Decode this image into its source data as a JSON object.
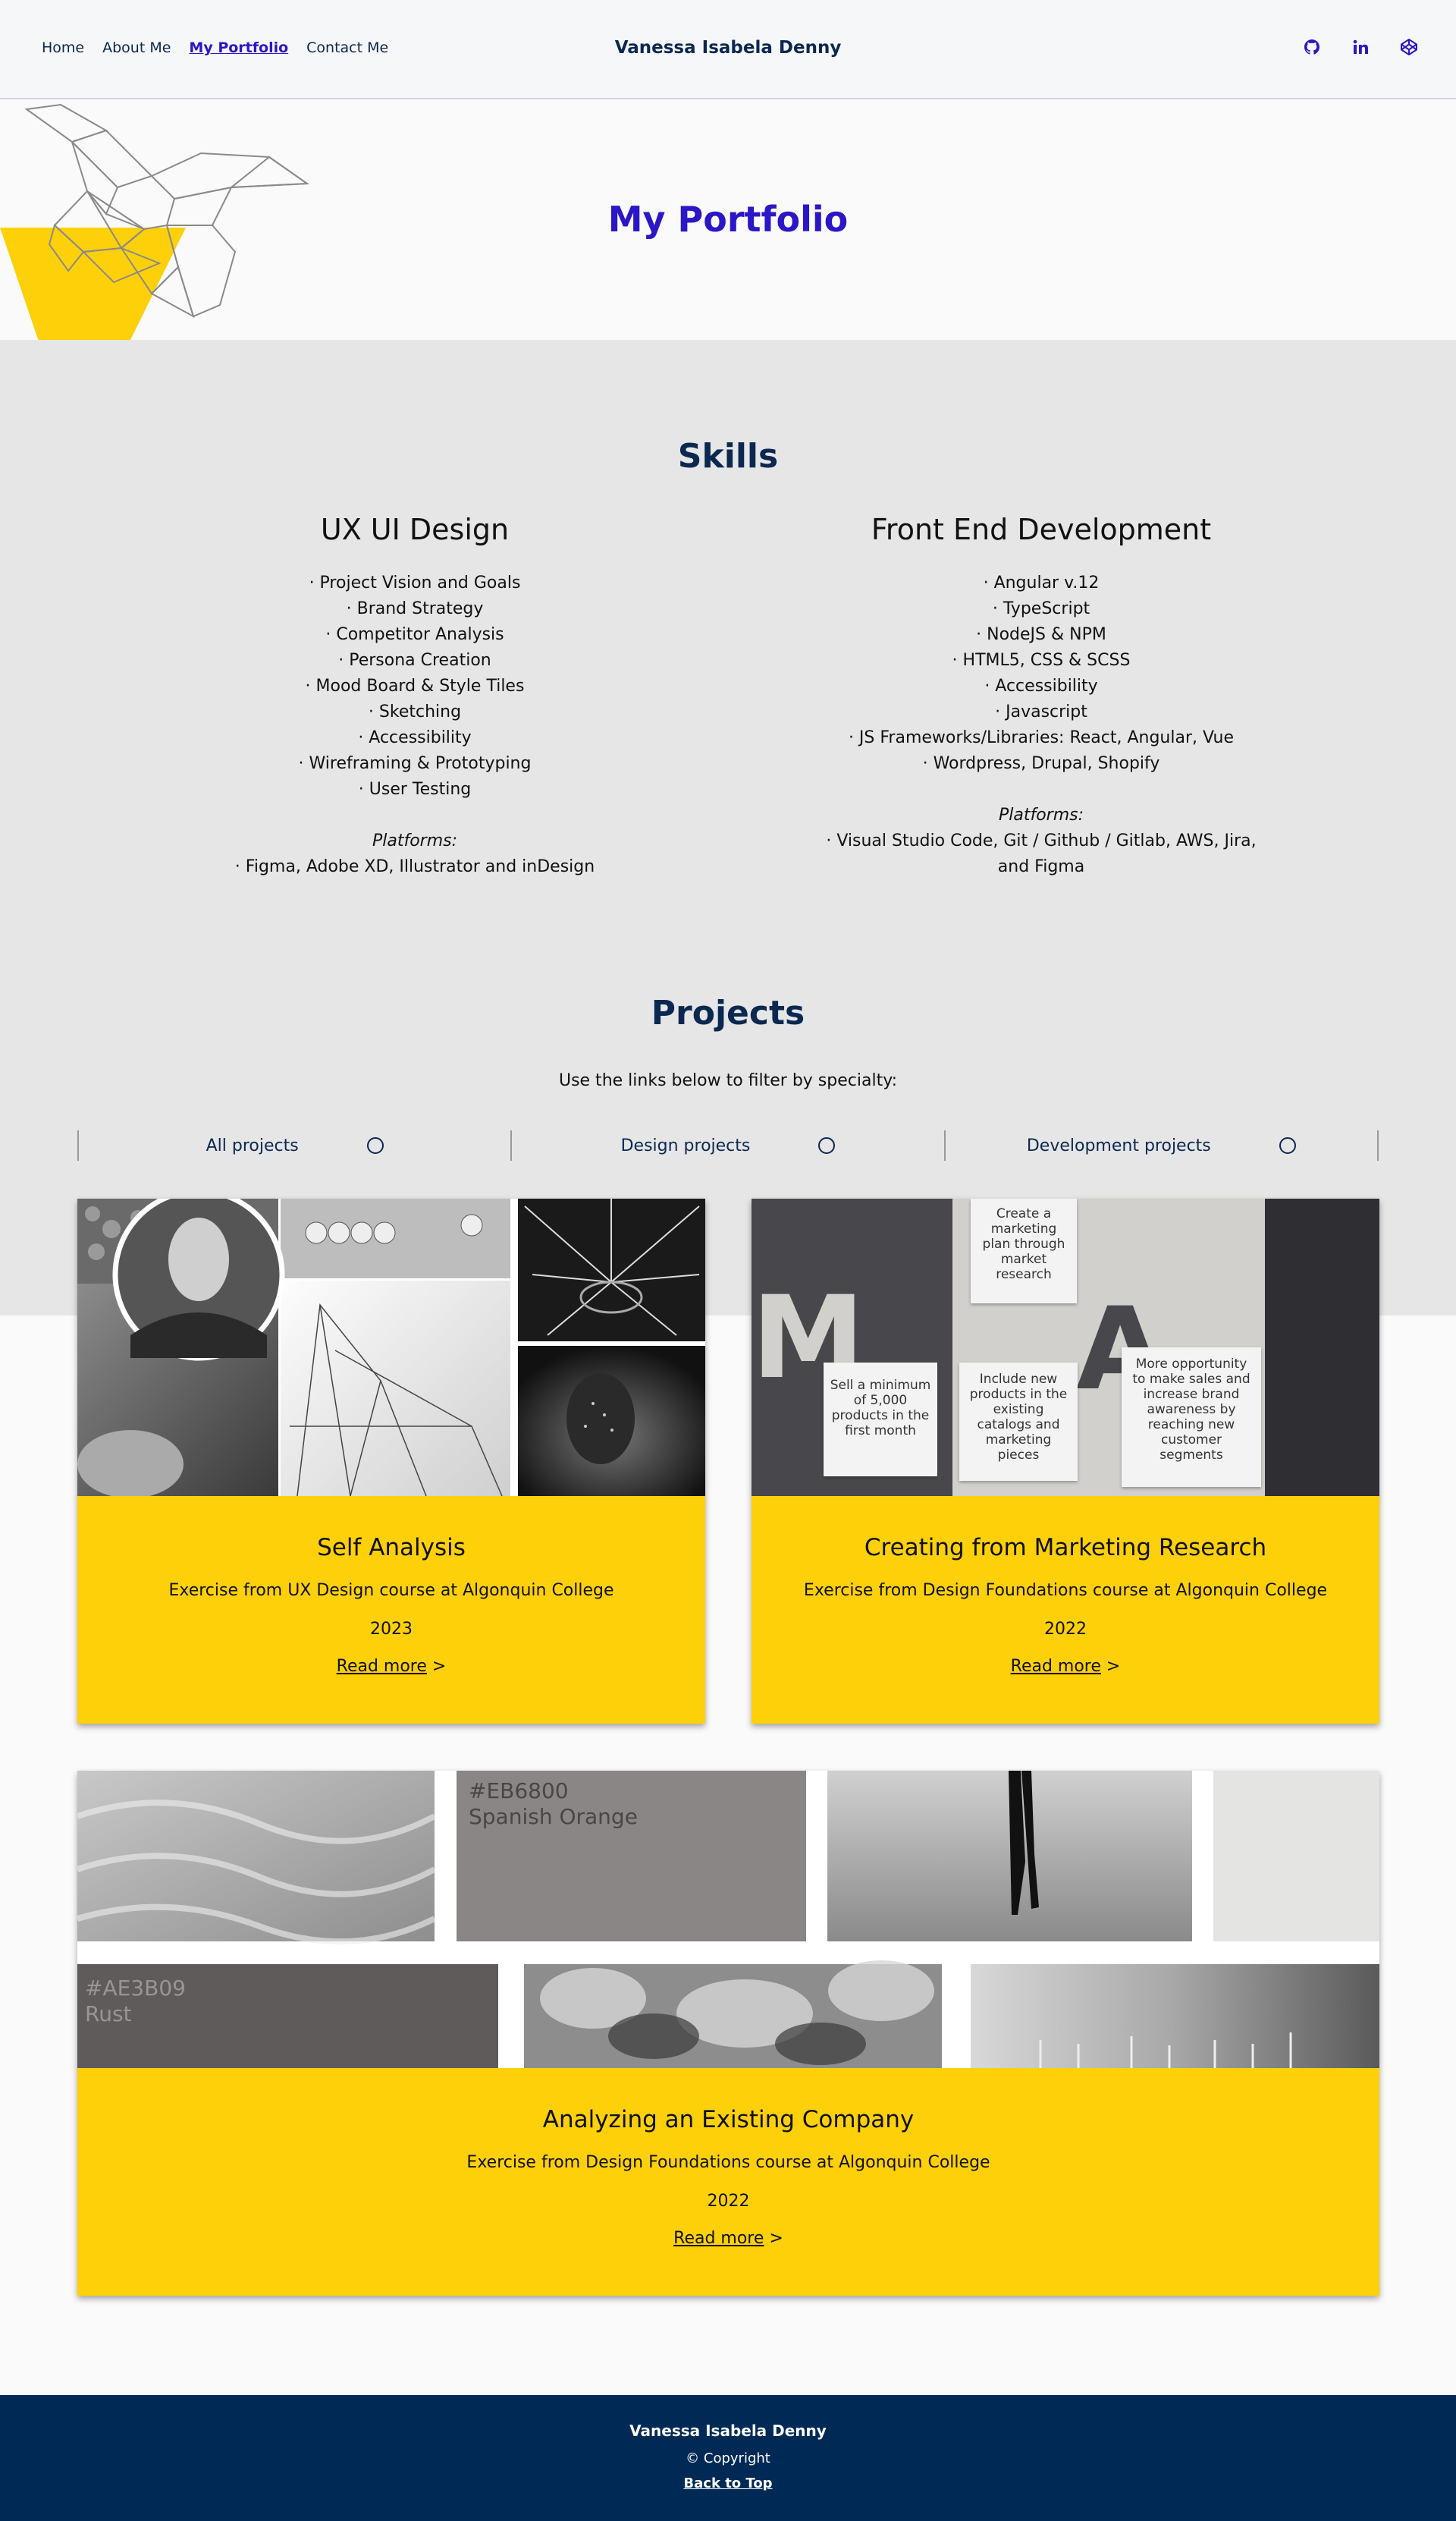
{
  "nav": {
    "links": [
      "Home",
      "About Me",
      "My Portfolio",
      "Contact Me"
    ],
    "brand": "Vanessa Isabela Denny",
    "social": [
      "github-icon",
      "linkedin-icon",
      "codepen-icon"
    ]
  },
  "hero": {
    "title": "My Portfolio"
  },
  "skills": {
    "title": "Skills",
    "ux": {
      "heading": "UX UI Design",
      "items": [
        "· Project Vision and Goals",
        "· Brand Strategy",
        "· Competitor Analysis",
        "· Persona Creation",
        "· Mood Board & Style Tiles",
        "· Sketching",
        "· Accessibility",
        "· Wireframing & Prototyping",
        "· User Testing"
      ],
      "platforms_label": "Platforms:",
      "platforms": "· Figma, Adobe XD, Illustrator and inDesign"
    },
    "fe": {
      "heading": "Front End Development",
      "items": [
        "· Angular v.12",
        "· TypeScript",
        "· NodeJS & NPM",
        "· HTML5, CSS & SCSS",
        "· Accessibility",
        "· Javascript",
        "· JS Frameworks/Libraries: React, Angular, Vue",
        "· Wordpress, Drupal, Shopify"
      ],
      "platforms_label": "Platforms:",
      "platforms_line1": "· Visual Studio Code, Git / Github / Gitlab, AWS, Jira,",
      "platforms_line2": "and Figma"
    }
  },
  "projects": {
    "title": "Projects",
    "intro": "Use the links below to filter by specialty:",
    "filters": [
      "All projects",
      "Design projects",
      "Development projects"
    ],
    "read_more": "Read more",
    "read_more_arrow": ">",
    "cards": [
      {
        "title": "Self Analysis",
        "desc": "Exercise from UX Design course at Algonquin College",
        "year": "2023"
      },
      {
        "title": "Creating from Marketing Research",
        "desc": "Exercise from Design Foundations course at Algonquin College",
        "year": "2022",
        "notes": [
          "Create a marketing plan through market research",
          "Sell a minimum of 5,000 products in the first month",
          "Include new products in the existing catalogs and marketing pieces",
          "More opportunity to make sales and increase brand awareness by reaching new customer segments"
        ],
        "letters": [
          "M",
          "A"
        ]
      },
      {
        "title": "Analyzing an Existing Company",
        "desc": "Exercise from Design Foundations course at Algonquin College",
        "year": "2022",
        "swatches": [
          {
            "hex": "#EB6800",
            "name": "Spanish Orange"
          },
          {
            "hex": "#AE3B09",
            "name": "Rust"
          }
        ]
      }
    ]
  },
  "footer": {
    "name": "Vanessa Isabela Denny",
    "copyright": "©  Copyright",
    "back_to_top": "Back to Top"
  },
  "colors": {
    "accent": "#2b17c7",
    "navy": "#0b2850",
    "yellow": "#fdd00a",
    "footer": "#002a55",
    "grey": "#e6e6e6"
  }
}
